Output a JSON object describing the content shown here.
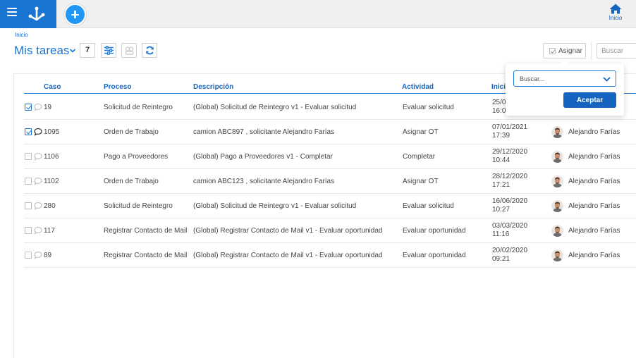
{
  "topbar": {
    "home_label": "Inicio",
    "brand_color": "#1976d2",
    "add_button_color": "#2196f3"
  },
  "breadcrumb": "Inicio",
  "page": {
    "title": "Mis tareas",
    "count": "7"
  },
  "toolbar": {
    "assign_label": "Asignar",
    "search_placeholder": "Buscar"
  },
  "table": {
    "columns": {
      "caso": "Caso",
      "proceso": "Proceso",
      "descripcion": "Descripción",
      "actividad": "Actividad",
      "inicio": "Inicio"
    },
    "rows": [
      {
        "checked": true,
        "comment": "light",
        "caso": "19",
        "proceso": "Solicitud de Reintegro",
        "descripcion": "(Global) Solicitud de Reintegro v1 - Evaluar solicitud",
        "actividad": "Evaluar solicitud",
        "fecha": "25/0",
        "hora": "16:0",
        "usuario": ""
      },
      {
        "checked": true,
        "comment": "dark",
        "caso": "1095",
        "proceso": "Orden de Trabajo",
        "descripcion": "camion ABC897 , solicitante Alejandro Farías",
        "actividad": "Asignar OT",
        "fecha": "07/01/2021",
        "hora": "17:39",
        "usuario": "Alejandro Farías"
      },
      {
        "checked": false,
        "comment": "light",
        "caso": "1106",
        "proceso": "Pago a Proveedores",
        "descripcion": "(Global) Pago a Proveedores v1 - Completar",
        "actividad": "Completar",
        "fecha": "29/12/2020",
        "hora": "10:44",
        "usuario": "Alejandro Farías"
      },
      {
        "checked": false,
        "comment": "light",
        "caso": "1102",
        "proceso": "Orden de Trabajo",
        "descripcion": "camion ABC123 , solicitante Alejandro Farías",
        "actividad": "Asignar OT",
        "fecha": "28/12/2020",
        "hora": "17:21",
        "usuario": "Alejandro Farías"
      },
      {
        "checked": false,
        "comment": "light",
        "caso": "280",
        "proceso": "Solicitud de Reintegro",
        "descripcion": "(Global) Solicitud de Reintegro v1 - Evaluar solicitud",
        "actividad": "Evaluar solicitud",
        "fecha": "16/06/2020",
        "hora": "10:27",
        "usuario": "Alejandro Farías"
      },
      {
        "checked": false,
        "comment": "light",
        "caso": "117",
        "proceso": "Registrar Contacto de Mail",
        "descripcion": "(Global) Registrar Contacto de Mail v1 - Evaluar oportunidad",
        "actividad": "Evaluar oportunidad",
        "fecha": "03/03/2020",
        "hora": "11:16",
        "usuario": "Alejandro Farías"
      },
      {
        "checked": false,
        "comment": "light",
        "caso": "89",
        "proceso": "Registrar Contacto de Mail",
        "descripcion": "(Global) Registrar Contacto de Mail v1 - Evaluar oportunidad",
        "actividad": "Evaluar oportunidad",
        "fecha": "20/02/2020",
        "hora": "09:21",
        "usuario": "Alejandro Farías"
      }
    ]
  },
  "assign_popup": {
    "select_placeholder": "Buscar...",
    "accept_label": "Aceptar"
  }
}
